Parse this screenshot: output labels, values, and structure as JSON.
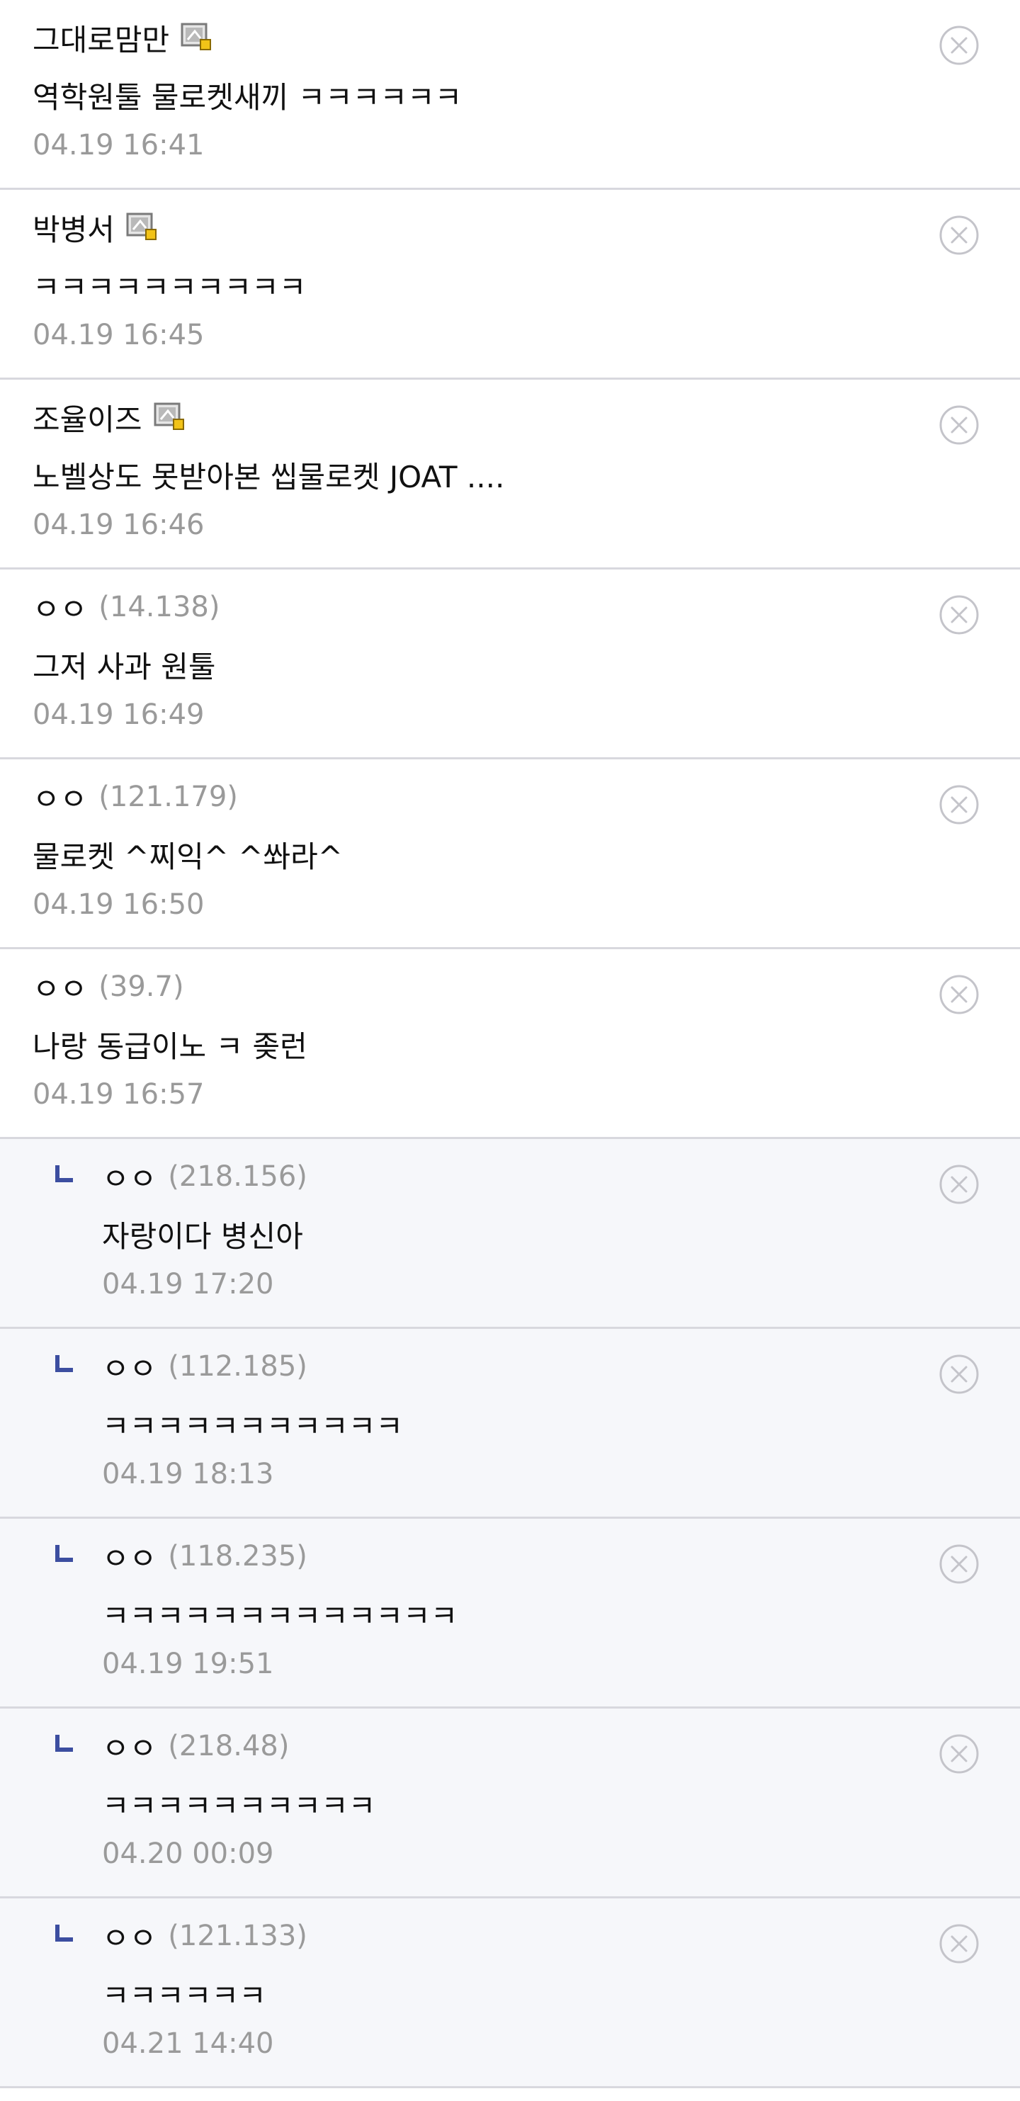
{
  "colors": {
    "reply_background": "#f6f7fa",
    "divider": "#d8d8de",
    "reply_mark": "#3c4ea0",
    "muted_text": "#9a9a9a",
    "delete_icon": "#c4c4ca"
  },
  "comments": [
    {
      "author": "그대로맘만",
      "ip": "",
      "fixed_nick_icon": "fixed-nick-icon",
      "text": "역학원툴 물로켓새끼 ㅋㅋㅋㅋㅋㅋ",
      "time": "04.19 16:41",
      "reply": false
    },
    {
      "author": "박병서",
      "ip": "",
      "fixed_nick_icon": "fixed-nick-icon",
      "text": "ㅋㅋㅋㅋㅋㅋㅋㅋㅋㅋ",
      "time": "04.19 16:45",
      "reply": false
    },
    {
      "author": "조율이즈",
      "ip": "",
      "fixed_nick_icon": "fixed-nick-icon",
      "text": "노벨상도 못받아본 씹물로켓 JOAT ....",
      "time": "04.19 16:46",
      "reply": false
    },
    {
      "author": "ㅇㅇ",
      "ip": "(14.138)",
      "fixed_nick_icon": "",
      "text": "그저 사과 원툴",
      "time": "04.19 16:49",
      "reply": false
    },
    {
      "author": "ㅇㅇ",
      "ip": "(121.179)",
      "fixed_nick_icon": "",
      "text": "물로켓 ^찌익^ ^쏴라^",
      "time": "04.19 16:50",
      "reply": false
    },
    {
      "author": "ㅇㅇ",
      "ip": "(39.7)",
      "fixed_nick_icon": "",
      "text": "나랑 동급이노 ㅋ 좆런",
      "time": "04.19 16:57",
      "reply": false
    },
    {
      "author": "ㅇㅇ",
      "ip": "(218.156)",
      "fixed_nick_icon": "",
      "text": "자랑이다 병신아",
      "time": "04.19 17:20",
      "reply": true
    },
    {
      "author": "ㅇㅇ",
      "ip": "(112.185)",
      "fixed_nick_icon": "",
      "text": "ㅋㅋㅋㅋㅋㅋㅋㅋㅋㅋㅋ",
      "time": "04.19 18:13",
      "reply": true
    },
    {
      "author": "ㅇㅇ",
      "ip": "(118.235)",
      "fixed_nick_icon": "",
      "text": "ㅋㅋㅋㅋㅋㅋㅋㅋㅋㅋㅋㅋㅋ",
      "time": "04.19 19:51",
      "reply": true
    },
    {
      "author": "ㅇㅇ",
      "ip": "(218.48)",
      "fixed_nick_icon": "",
      "text": "ㅋㅋㅋㅋㅋㅋㅋㅋㅋㅋ",
      "time": "04.20 00:09",
      "reply": true
    },
    {
      "author": "ㅇㅇ",
      "ip": "(121.133)",
      "fixed_nick_icon": "",
      "text": "ㅋㅋㅋㅋㅋㅋ",
      "time": "04.21 14:40",
      "reply": true
    }
  ]
}
